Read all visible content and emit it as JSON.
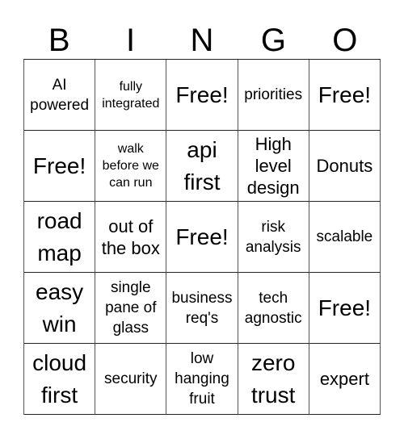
{
  "header": {
    "letters": [
      "B",
      "I",
      "N",
      "G",
      "O"
    ]
  },
  "cells": [
    [
      {
        "text": "AI\npowered",
        "size": "m"
      },
      {
        "text": "fully\nintegrated",
        "size": "s"
      },
      {
        "text": "Free!",
        "size": "xl"
      },
      {
        "text": "priorities",
        "size": "m"
      },
      {
        "text": "Free!",
        "size": "xl"
      }
    ],
    [
      {
        "text": "Free!",
        "size": "xl"
      },
      {
        "text": "walk\nbefore we\ncan run",
        "size": "s"
      },
      {
        "text": "api\nfirst",
        "size": "xl"
      },
      {
        "text": "High\nlevel\ndesign",
        "size": "l"
      },
      {
        "text": "Donuts",
        "size": "l"
      }
    ],
    [
      {
        "text": "road\nmap",
        "size": "xl"
      },
      {
        "text": "out of\nthe box",
        "size": "l"
      },
      {
        "text": "Free!",
        "size": "xl"
      },
      {
        "text": "risk\nanalysis",
        "size": "m"
      },
      {
        "text": "scalable",
        "size": "m"
      }
    ],
    [
      {
        "text": "easy\nwin",
        "size": "xl"
      },
      {
        "text": "single\npane of\nglass",
        "size": "m"
      },
      {
        "text": "business\nreq's",
        "size": "m"
      },
      {
        "text": "tech\nagnostic",
        "size": "m"
      },
      {
        "text": "Free!",
        "size": "xl"
      }
    ],
    [
      {
        "text": "cloud\nfirst",
        "size": "xl"
      },
      {
        "text": "security",
        "size": "m"
      },
      {
        "text": "low\nhanging\nfruit",
        "size": "m"
      },
      {
        "text": "zero\ntrust",
        "size": "xl"
      },
      {
        "text": "expert",
        "size": "l"
      }
    ]
  ]
}
